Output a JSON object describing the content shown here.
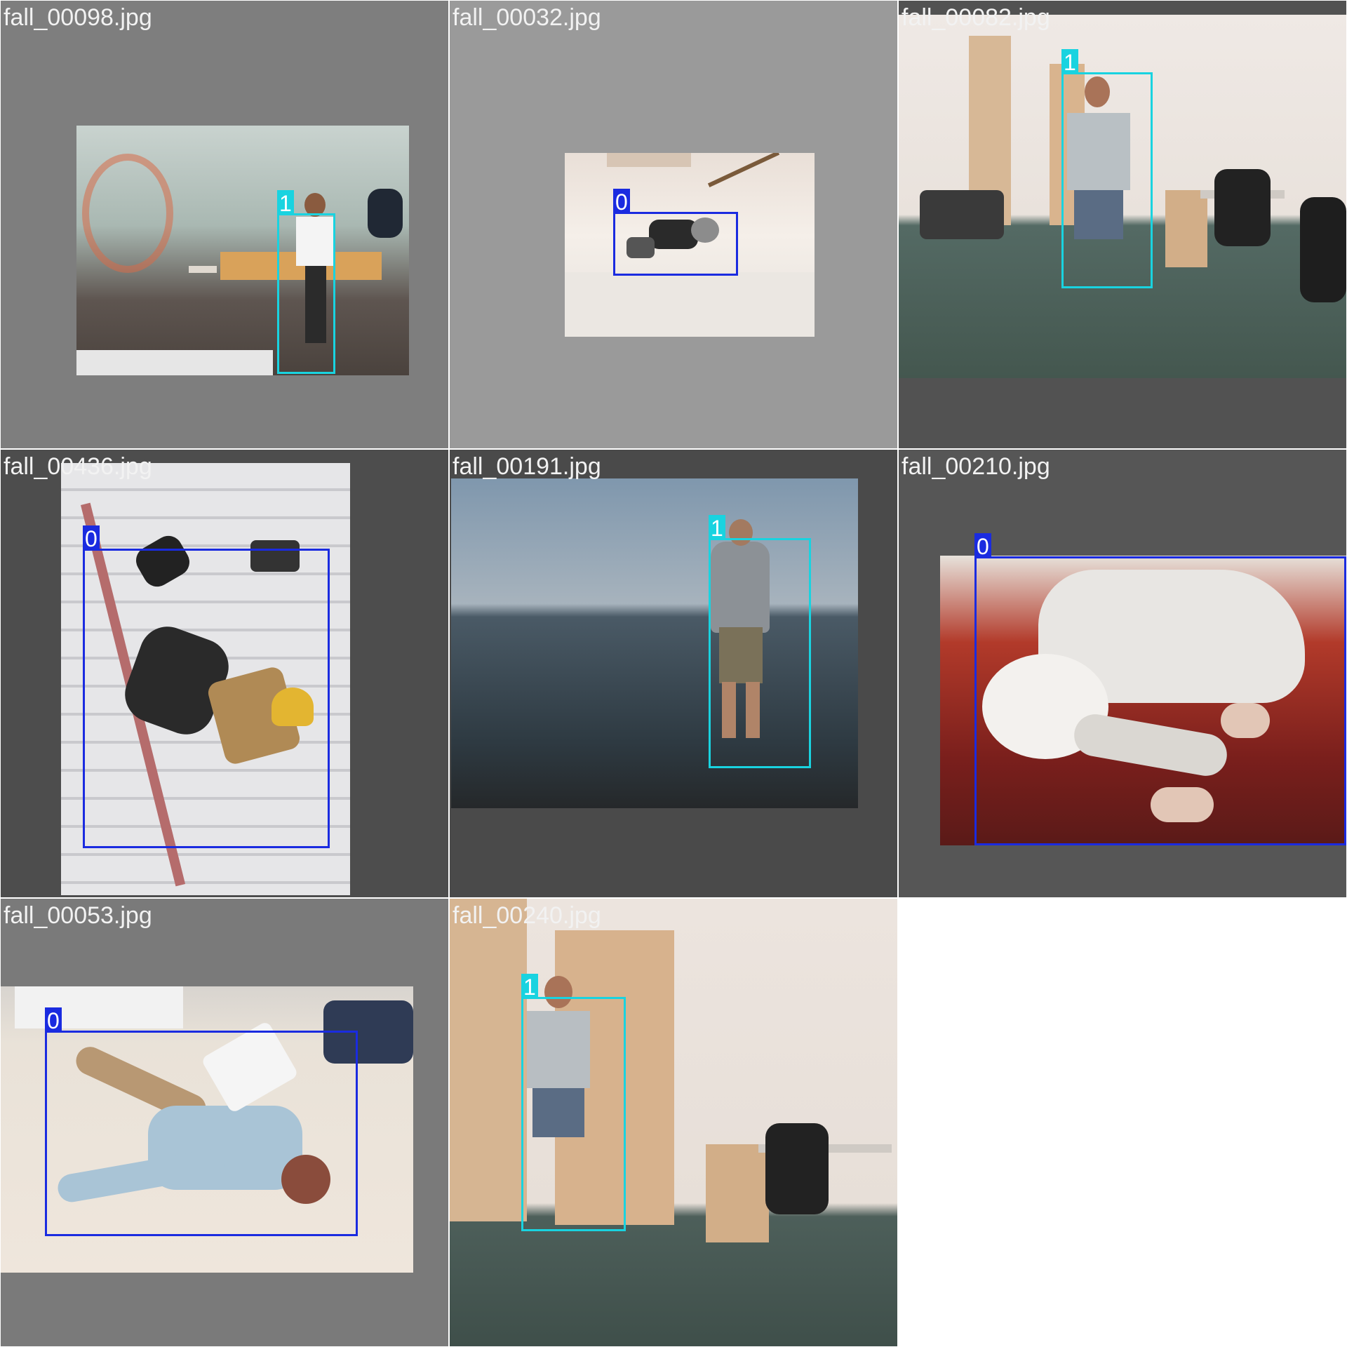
{
  "mosaic": {
    "tiles": [
      {
        "filename": "fall_00098.jpg",
        "labels": [
          "1"
        ]
      },
      {
        "filename": "fall_00032.jpg",
        "labels": [
          "0"
        ]
      },
      {
        "filename": "fall_00082.jpg",
        "labels": [
          "1"
        ]
      },
      {
        "filename": "fall_00436.jpg",
        "labels": [
          "0"
        ]
      },
      {
        "filename": "fall_00191.jpg",
        "labels": [
          "1"
        ]
      },
      {
        "filename": "fall_00210.jpg",
        "labels": [
          "0"
        ]
      },
      {
        "filename": "fall_00053.jpg",
        "labels": [
          "0"
        ]
      },
      {
        "filename": "fall_00240.jpg",
        "labels": [
          "1"
        ]
      }
    ]
  },
  "colors": {
    "class_0_box": "#1a2be0",
    "class_1_box": "#19d3e0",
    "filename_text": "#f2f2f2"
  }
}
